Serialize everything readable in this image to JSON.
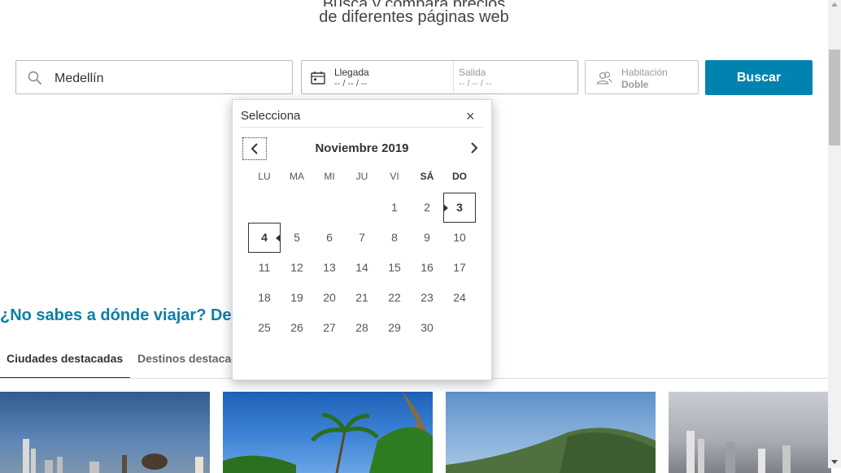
{
  "header": {
    "line1": "Busca y compara precios",
    "line2": "de diferentes páginas web"
  },
  "search": {
    "destination": "Medellín",
    "arrival_label": "Llegada",
    "arrival_value": "-- / -- / --",
    "departure_label": "Salida",
    "departure_value": "-- / -- / --",
    "room_label": "Habitación",
    "room_value": "Doble",
    "button": "Buscar"
  },
  "section": {
    "title": "¿No sabes a dónde viajar? Descubre nuevos destinos",
    "tabs": [
      "Ciudades destacadas",
      "Destinos destacados"
    ]
  },
  "datepicker": {
    "title": "Selecciona",
    "close": "×",
    "month": "Noviembre 2019",
    "weekdays": [
      "LU",
      "MA",
      "MI",
      "JU",
      "VI",
      "SÁ",
      "DO"
    ],
    "rows": [
      [
        "",
        "",
        "",
        "",
        "1",
        "2",
        "3"
      ],
      [
        "4",
        "5",
        "6",
        "7",
        "8",
        "9",
        "10"
      ],
      [
        "11",
        "12",
        "13",
        "14",
        "15",
        "16",
        "17"
      ],
      [
        "18",
        "19",
        "20",
        "21",
        "22",
        "23",
        "24"
      ],
      [
        "25",
        "26",
        "27",
        "28",
        "29",
        "30",
        ""
      ]
    ],
    "selected_start": "3",
    "selected_end": "4"
  },
  "colors": {
    "accent": "#0083ae",
    "title": "#0a7fa6"
  },
  "icons": [
    "search-icon",
    "calendar-icon",
    "users-icon",
    "chevron-left-icon",
    "chevron-right-icon",
    "close-icon"
  ]
}
